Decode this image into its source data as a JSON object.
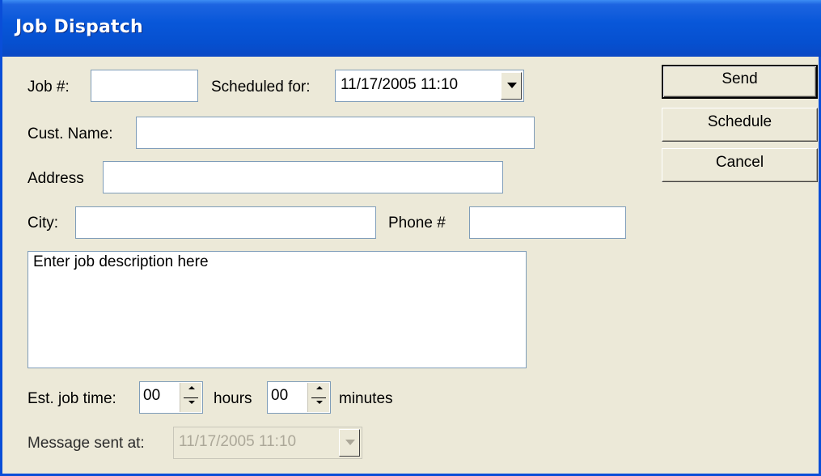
{
  "window": {
    "title": "Job Dispatch"
  },
  "form": {
    "job_number": {
      "label": "Job #:",
      "value": ""
    },
    "scheduled_for": {
      "label": "Scheduled for:",
      "value": "11/17/2005  11:10"
    },
    "customer_name": {
      "label": "Cust. Name:",
      "value": ""
    },
    "address": {
      "label": "Address",
      "value": ""
    },
    "city": {
      "label": "City:",
      "value": ""
    },
    "phone": {
      "label": "Phone #",
      "value": ""
    },
    "description": {
      "value": "Enter job description here"
    },
    "est_job_time": {
      "label": "Est. job time:",
      "hours_value": "00",
      "hours_label": "hours",
      "minutes_value": "00",
      "minutes_label": "minutes"
    },
    "message_sent_at": {
      "label": "Message sent at:",
      "value": "11/17/2005  11:10",
      "enabled": false
    }
  },
  "buttons": {
    "send": "Send",
    "schedule": "Schedule",
    "cancel": "Cancel"
  },
  "colors": {
    "title_bar": "#0857d9",
    "dialog_bg": "#ece9d8",
    "field_border": "#7f9db9",
    "disabled_text": "#aca899"
  },
  "icons": {
    "dropdown": "chevron-down-icon",
    "spin_up": "spin-up-icon",
    "spin_down": "spin-down-icon"
  }
}
